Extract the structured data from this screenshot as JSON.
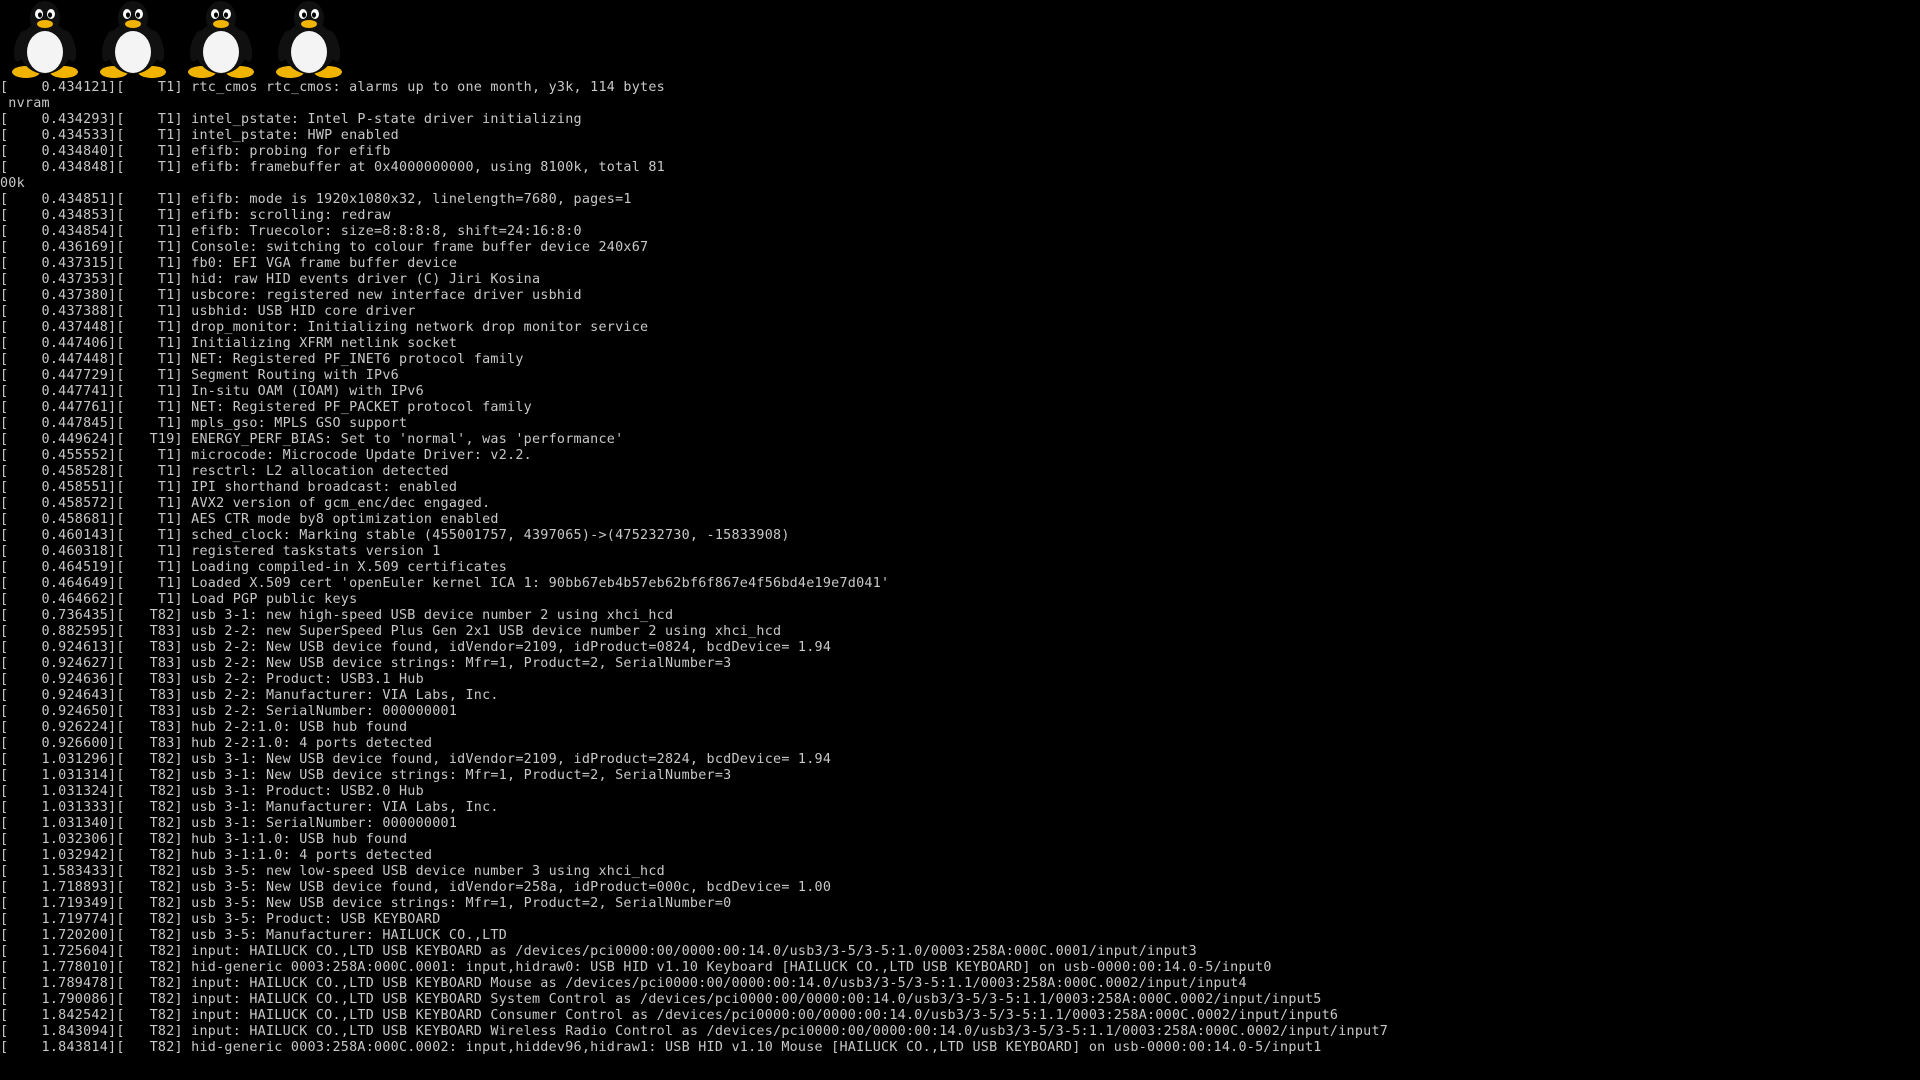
{
  "screen": {
    "background_color": "#000000",
    "text_color": "#c8c8c8",
    "logo_count": 4,
    "logo_icon": "tux-penguin-icon"
  },
  "console": {
    "lines": [
      "[    0.434121][    T1] rtc_cmos rtc_cmos: alarms up to one month, y3k, 114 bytes",
      " nvram",
      "[    0.434293][    T1] intel_pstate: Intel P-state driver initializing",
      "[    0.434533][    T1] intel_pstate: HWP enabled",
      "[    0.434840][    T1] efifb: probing for efifb",
      "[    0.434848][    T1] efifb: framebuffer at 0x4000000000, using 8100k, total 81",
      "00k",
      "[    0.434851][    T1] efifb: mode is 1920x1080x32, linelength=7680, pages=1",
      "[    0.434853][    T1] efifb: scrolling: redraw",
      "[    0.434854][    T1] efifb: Truecolor: size=8:8:8:8, shift=24:16:8:0",
      "[    0.436169][    T1] Console: switching to colour frame buffer device 240x67",
      "[    0.437315][    T1] fb0: EFI VGA frame buffer device",
      "[    0.437353][    T1] hid: raw HID events driver (C) Jiri Kosina",
      "[    0.437380][    T1] usbcore: registered new interface driver usbhid",
      "[    0.437388][    T1] usbhid: USB HID core driver",
      "[    0.437448][    T1] drop_monitor: Initializing network drop monitor service",
      "[    0.447406][    T1] Initializing XFRM netlink socket",
      "[    0.447448][    T1] NET: Registered PF_INET6 protocol family",
      "[    0.447729][    T1] Segment Routing with IPv6",
      "[    0.447741][    T1] In-situ OAM (IOAM) with IPv6",
      "[    0.447761][    T1] NET: Registered PF_PACKET protocol family",
      "[    0.447845][    T1] mpls_gso: MPLS GSO support",
      "[    0.449624][   T19] ENERGY_PERF_BIAS: Set to 'normal', was 'performance'",
      "[    0.455552][    T1] microcode: Microcode Update Driver: v2.2.",
      "[    0.458528][    T1] resctrl: L2 allocation detected",
      "[    0.458551][    T1] IPI shorthand broadcast: enabled",
      "[    0.458572][    T1] AVX2 version of gcm_enc/dec engaged.",
      "[    0.458681][    T1] AES CTR mode by8 optimization enabled",
      "[    0.460143][    T1] sched_clock: Marking stable (455001757, 4397065)->(475232730, -15833908)",
      "[    0.460318][    T1] registered taskstats version 1",
      "[    0.464519][    T1] Loading compiled-in X.509 certificates",
      "[    0.464649][    T1] Loaded X.509 cert 'openEuler kernel ICA 1: 90bb67eb4b57eb62bf6f867e4f56bd4e19e7d041'",
      "[    0.464662][    T1] Load PGP public keys",
      "[    0.736435][   T82] usb 3-1: new high-speed USB device number 2 using xhci_hcd",
      "[    0.882595][   T83] usb 2-2: new SuperSpeed Plus Gen 2x1 USB device number 2 using xhci_hcd",
      "[    0.924613][   T83] usb 2-2: New USB device found, idVendor=2109, idProduct=0824, bcdDevice= 1.94",
      "[    0.924627][   T83] usb 2-2: New USB device strings: Mfr=1, Product=2, SerialNumber=3",
      "[    0.924636][   T83] usb 2-2: Product: USB3.1 Hub",
      "[    0.924643][   T83] usb 2-2: Manufacturer: VIA Labs, Inc.",
      "[    0.924650][   T83] usb 2-2: SerialNumber: 000000001",
      "[    0.926224][   T83] hub 2-2:1.0: USB hub found",
      "[    0.926600][   T83] hub 2-2:1.0: 4 ports detected",
      "[    1.031296][   T82] usb 3-1: New USB device found, idVendor=2109, idProduct=2824, bcdDevice= 1.94",
      "[    1.031314][   T82] usb 3-1: New USB device strings: Mfr=1, Product=2, SerialNumber=3",
      "[    1.031324][   T82] usb 3-1: Product: USB2.0 Hub",
      "[    1.031333][   T82] usb 3-1: Manufacturer: VIA Labs, Inc.",
      "[    1.031340][   T82] usb 3-1: SerialNumber: 000000001",
      "[    1.032306][   T82] hub 3-1:1.0: USB hub found",
      "[    1.032942][   T82] hub 3-1:1.0: 4 ports detected",
      "[    1.583433][   T82] usb 3-5: new low-speed USB device number 3 using xhci_hcd",
      "[    1.718893][   T82] usb 3-5: New USB device found, idVendor=258a, idProduct=000c, bcdDevice= 1.00",
      "[    1.719349][   T82] usb 3-5: New USB device strings: Mfr=1, Product=2, SerialNumber=0",
      "[    1.719774][   T82] usb 3-5: Product: USB KEYBOARD",
      "[    1.720200][   T82] usb 3-5: Manufacturer: HAILUCK CO.,LTD",
      "[    1.725604][   T82] input: HAILUCK CO.,LTD USB KEYBOARD as /devices/pci0000:00/0000:00:14.0/usb3/3-5/3-5:1.0/0003:258A:000C.0001/input/input3",
      "[    1.778010][   T82] hid-generic 0003:258A:000C.0001: input,hidraw0: USB HID v1.10 Keyboard [HAILUCK CO.,LTD USB KEYBOARD] on usb-0000:00:14.0-5/input0",
      "[    1.789478][   T82] input: HAILUCK CO.,LTD USB KEYBOARD Mouse as /devices/pci0000:00/0000:00:14.0/usb3/3-5/3-5:1.1/0003:258A:000C.0002/input/input4",
      "[    1.790086][   T82] input: HAILUCK CO.,LTD USB KEYBOARD System Control as /devices/pci0000:00/0000:00:14.0/usb3/3-5/3-5:1.1/0003:258A:000C.0002/input/input5",
      "[    1.842542][   T82] input: HAILUCK CO.,LTD USB KEYBOARD Consumer Control as /devices/pci0000:00/0000:00:14.0/usb3/3-5/3-5:1.1/0003:258A:000C.0002/input/input6",
      "[    1.843094][   T82] input: HAILUCK CO.,LTD USB KEYBOARD Wireless Radio Control as /devices/pci0000:00/0000:00:14.0/usb3/3-5/3-5:1.1/0003:258A:000C.0002/input/input7",
      "[    1.843814][   T82] hid-generic 0003:258A:000C.0002: input,hiddev96,hidraw1: USB HID v1.10 Mouse [HAILUCK CO.,LTD USB KEYBOARD] on usb-0000:00:14.0-5/input1"
    ]
  }
}
